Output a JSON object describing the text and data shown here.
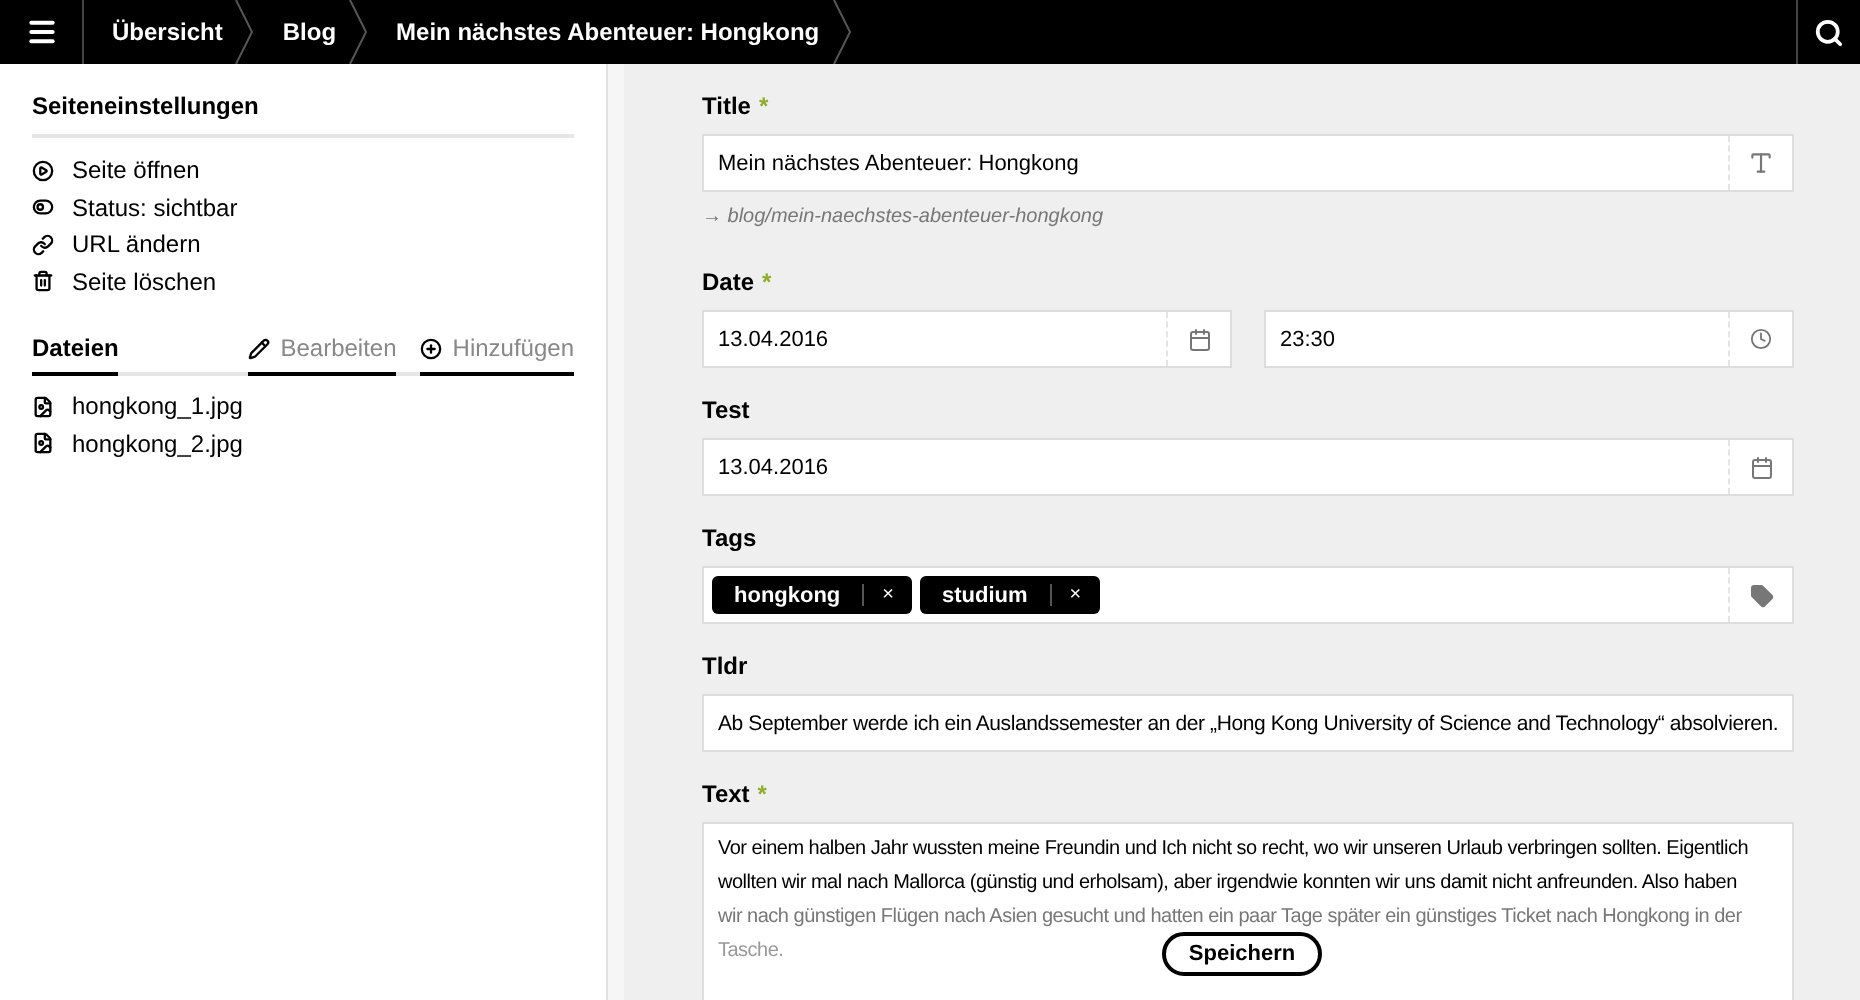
{
  "breadcrumbs": [
    "Übersicht",
    "Blog",
    "Mein nächstes Abenteuer: Hongkong"
  ],
  "sidebar": {
    "title": "Seiteneinstellungen",
    "actions": [
      {
        "kind": "open",
        "label": "Seite öffnen"
      },
      {
        "kind": "status",
        "label": "Status: sichtbar"
      },
      {
        "kind": "url",
        "label": "URL ändern"
      },
      {
        "kind": "delete",
        "label": "Seite löschen"
      }
    ],
    "files": {
      "title": "Dateien",
      "buttons": [
        {
          "kind": "edit",
          "label": "Bearbeiten"
        },
        {
          "kind": "add",
          "label": "Hinzufügen"
        }
      ],
      "items": [
        "hongkong_1.jpg",
        "hongkong_2.jpg"
      ]
    }
  },
  "fields": [
    {
      "kind": "text",
      "label": "Title",
      "marker": "*",
      "value": "Mein nächstes Abenteuer: Hongkong",
      "hint": "→ blog/mein-naechstes-abenteuer-hongkong"
    },
    {
      "kind": "datetime",
      "label": "Date",
      "marker": "*",
      "value": "13.04.2016",
      "time": "23:30"
    },
    {
      "kind": "date",
      "label": "Test",
      "value": "13.04.2016"
    },
    {
      "kind": "tags",
      "label": "Tags",
      "tags": [
        "hongkong",
        "studium"
      ],
      "remove": "×"
    },
    {
      "kind": "plain",
      "label": "Tldr",
      "value": "Ab September werde ich ein Auslandssemester an der „Hong Kong University of Science and Technology“ absolvieren."
    },
    {
      "kind": "textarea",
      "label": "Text",
      "marker": "*",
      "lines": [
        "Vor einem halben Jahr wussten meine Freundin und Ich nicht so recht, wo wir unseren Urlaub verbringen sollten. Eigentlich",
        "wollten wir mal nach Mallorca (günstig und erholsam), aber irgendwie konnten wir uns damit nicht anfreunden. Also haben",
        "wir nach günstigen Flügen nach Asien gesucht und hatten ein paar Tage später ein günstiges Ticket nach Hongkong in der",
        "Tasche."
      ]
    }
  ],
  "save_button": "Speichern"
}
